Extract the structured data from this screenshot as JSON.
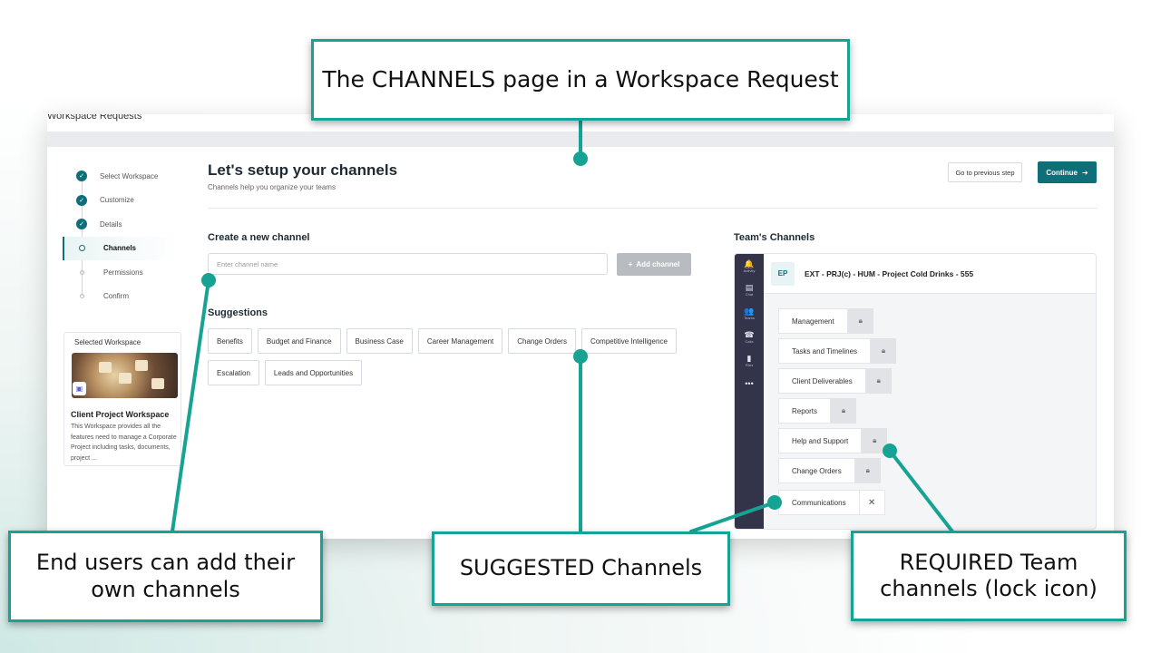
{
  "app": {
    "title": "Workspace Requests"
  },
  "steps": [
    {
      "label": "Select Workspace",
      "state": "done"
    },
    {
      "label": "Customize",
      "state": "done"
    },
    {
      "label": "Details",
      "state": "done"
    },
    {
      "label": "Channels",
      "state": "current"
    },
    {
      "label": "Permissions",
      "state": "todo"
    },
    {
      "label": "Confirm",
      "state": "todo"
    }
  ],
  "selected_workspace": {
    "caption": "Selected Workspace",
    "name": "Client Project Workspace",
    "description": "This Workspace provides all the features need to manage a Corporate Project including tasks, documents, project ..."
  },
  "header": {
    "title": "Let's setup your channels",
    "subtitle": "Channels help you organize your teams",
    "prev_label": "Go to previous step",
    "continue_label": "Continue"
  },
  "create": {
    "title": "Create a new channel",
    "placeholder": "Enter channel name",
    "add_label": "Add channel"
  },
  "suggestions": {
    "title": "Suggestions",
    "items": [
      "Benefits",
      "Budget and Finance",
      "Business Case",
      "Career Management",
      "Change Orders",
      "Competitive Intelligence",
      "Escalation",
      "Leads and Opportunities"
    ]
  },
  "teams": {
    "title": "Team's Channels",
    "rail": [
      {
        "icon": "bell-icon",
        "glyph": "🔔",
        "label": "Activity"
      },
      {
        "icon": "chat-icon",
        "glyph": "▤",
        "label": "Chat"
      },
      {
        "icon": "teams-icon",
        "glyph": "👥",
        "label": "Teams"
      },
      {
        "icon": "calls-icon",
        "glyph": "☎",
        "label": "Calls"
      },
      {
        "icon": "files-icon",
        "glyph": "▮",
        "label": "Files"
      },
      {
        "icon": "more-icon",
        "glyph": "•••",
        "label": ""
      }
    ],
    "avatar": "EP",
    "team_name": "EXT - PRJ(c) - HUM - Project Cold Drinks - 555",
    "channels": [
      {
        "label": "Management",
        "type": "required"
      },
      {
        "label": "Tasks and Timelines",
        "type": "required"
      },
      {
        "label": "Client Deliverables",
        "type": "required"
      },
      {
        "label": "Reports",
        "type": "required"
      },
      {
        "label": "Help and Support",
        "type": "required"
      },
      {
        "label": "Change Orders",
        "type": "required"
      },
      {
        "label": "Communications",
        "type": "removable"
      }
    ]
  },
  "callouts": {
    "top": "The CHANNELS page in a Workspace Request",
    "left": "End users can add their own channels",
    "mid": "SUGGESTED Channels",
    "right": "REQUIRED Team channels (lock icon)"
  },
  "colors": {
    "accent": "#0f6f78",
    "callout_border": "#17a394",
    "rail": "#33344a"
  }
}
